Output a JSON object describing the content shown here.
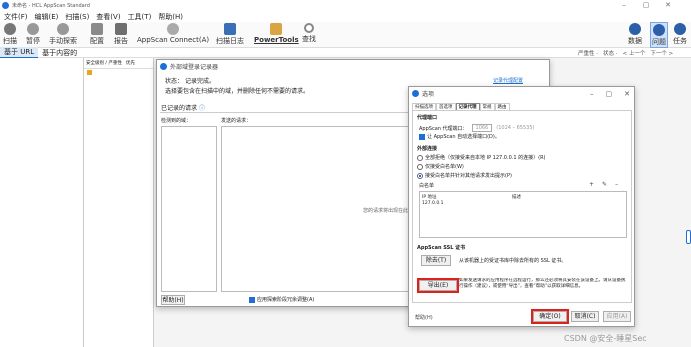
{
  "window": {
    "title": "未命名 - HCL AppScan Standard",
    "controls": [
      "–",
      "▢",
      "✕"
    ]
  },
  "menu": [
    "文件(F)",
    "编辑(E)",
    "扫描(S)",
    "查看(V)",
    "工具(T)",
    "帮助(H)"
  ],
  "toolbar": {
    "scan": "扫描",
    "pause": "暂停",
    "manual_explore": "手动探索",
    "config": "配置",
    "report": "报告",
    "appscan_connect": "AppScan Connect(A)",
    "scan_log": "扫描日志",
    "powertools": "PowerTools",
    "find": "查找",
    "data": "数据",
    "issues": "问题",
    "tasks": "任务"
  },
  "view_tabs": {
    "by_url": "基于 URL",
    "by_content": "基于内容的"
  },
  "filter_bar": {
    "severity": "严重性 ·",
    "status": "状态 ·",
    "prev": "< 上一个",
    "next": "下一个 >"
  },
  "list_header": {
    "col1": "安全级别 / 严重性",
    "col2": "优先"
  },
  "bg_dialog": {
    "title": "外部域登录记录器",
    "status_label": "状态：",
    "status_value": "记录完成。",
    "instruction": "选择要包含在扫描中的域，并删除任何不需要的请求。",
    "proxy_config_link": "记录代理配置",
    "recorded_requests": "已记录的请求",
    "detected_domains": "检测到的域：",
    "sent_requests": "发送的请求：",
    "placeholder": "您的请求将出现在此",
    "help_button": "帮助(H)",
    "auto_tune_label": "应用探索阶段冗余调整(A)"
  },
  "options_dialog": {
    "title": "选项",
    "tabs": [
      "扫描选项",
      "首选项",
      "记录代理",
      "常规",
      "路由"
    ],
    "proxy_port_group": "代理端口",
    "proxy_port_label": "AppScan 代理端口：",
    "proxy_port_value": "1066",
    "proxy_port_range": "(1024 – 65535)",
    "auto_port_checkbox": "让 AppScan 自动选择端口(D)。",
    "external_group": "外部连接",
    "radio_all": "全部拒绝（仅接受来自本地 IP 127.0.0.1 的连接）(R)",
    "radio_whitelist": "仅接受白名单(W)",
    "radio_prompt": "接受白名单并针对其他请求发出提示(P)",
    "whitelist_label": "白名单",
    "whitelist_col_ip": "IP 地址",
    "whitelist_col_desc": "描述",
    "whitelist_row_ip": "127.0.0.1",
    "ssl_group": "AppScan SSL 证书",
    "remove_button": "除去(T)",
    "remove_desc": "从该机器上的受证书库中除去所有的 SSL 证书。",
    "export_button": "导出(E)",
    "export_desc": "如果发送请求的应用程序在远程运行，那么还必须将其安装在该设备上。请从设备执行操作（建议），或使用“导出”，查看“帮助”以获取详细信息。",
    "help_link": "帮助(H)",
    "ok_button": "确定(O)",
    "cancel_button": "取消(C)",
    "apply_button": "应用(A)"
  },
  "watermark": "CSDN @安全-睡星Sec",
  "colors": {
    "accent": "#1d6fd6",
    "highlight": "#e0201a"
  }
}
